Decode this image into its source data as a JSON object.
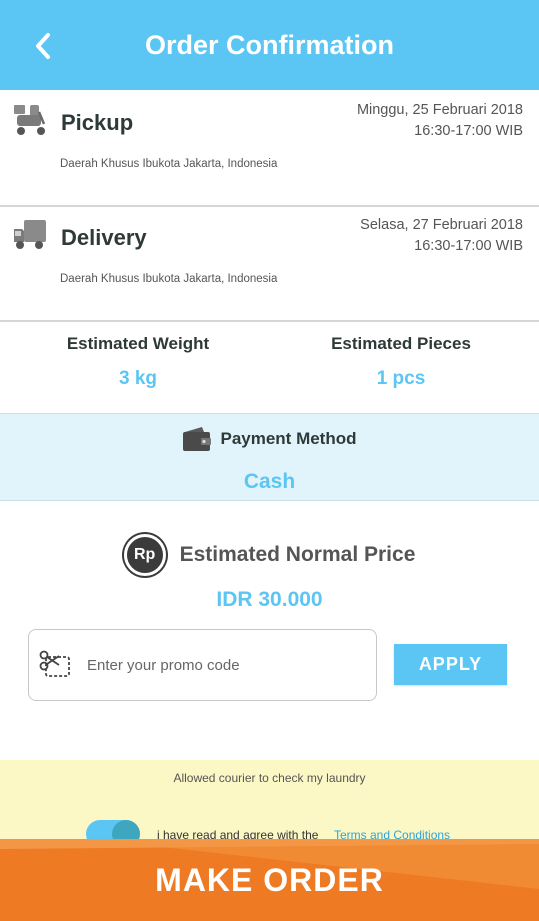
{
  "header": {
    "title": "Order Confirmation"
  },
  "pickup": {
    "title": "Pickup",
    "date": "Minggu, 25 Februari 2018",
    "time": "16:30-17:00 WIB",
    "address": "Daerah Khusus Ibukota Jakarta, Indonesia"
  },
  "delivery": {
    "title": "Delivery",
    "date": "Selasa, 27 Februari 2018",
    "time": "16:30-17:00 WIB",
    "address": "Daerah Khusus Ibukota Jakarta, Indonesia"
  },
  "estimates": {
    "weight_label": "Estimated Weight",
    "weight_value": "3 kg",
    "pieces_label": "Estimated Pieces",
    "pieces_value": "1 pcs"
  },
  "payment": {
    "label": "Payment Method",
    "value": "Cash"
  },
  "price": {
    "badge": "Rp",
    "label": "Estimated Normal Price",
    "value": "IDR 30.000"
  },
  "promo": {
    "placeholder": "Enter your promo code",
    "value": "",
    "apply_label": "APPLY"
  },
  "agreement": {
    "courier_note": "Allowed courier to check my laundry",
    "agree_text": "i have read and agree with the",
    "terms_link": "Terms and Conditions",
    "toggle_on": true
  },
  "order_button": {
    "label": "MAKE ORDER"
  },
  "colors": {
    "accent": "#5bc6f4",
    "order": "#ee7a23",
    "note_bg": "#fbf8c6",
    "payment_bg": "#e1f4fb"
  }
}
